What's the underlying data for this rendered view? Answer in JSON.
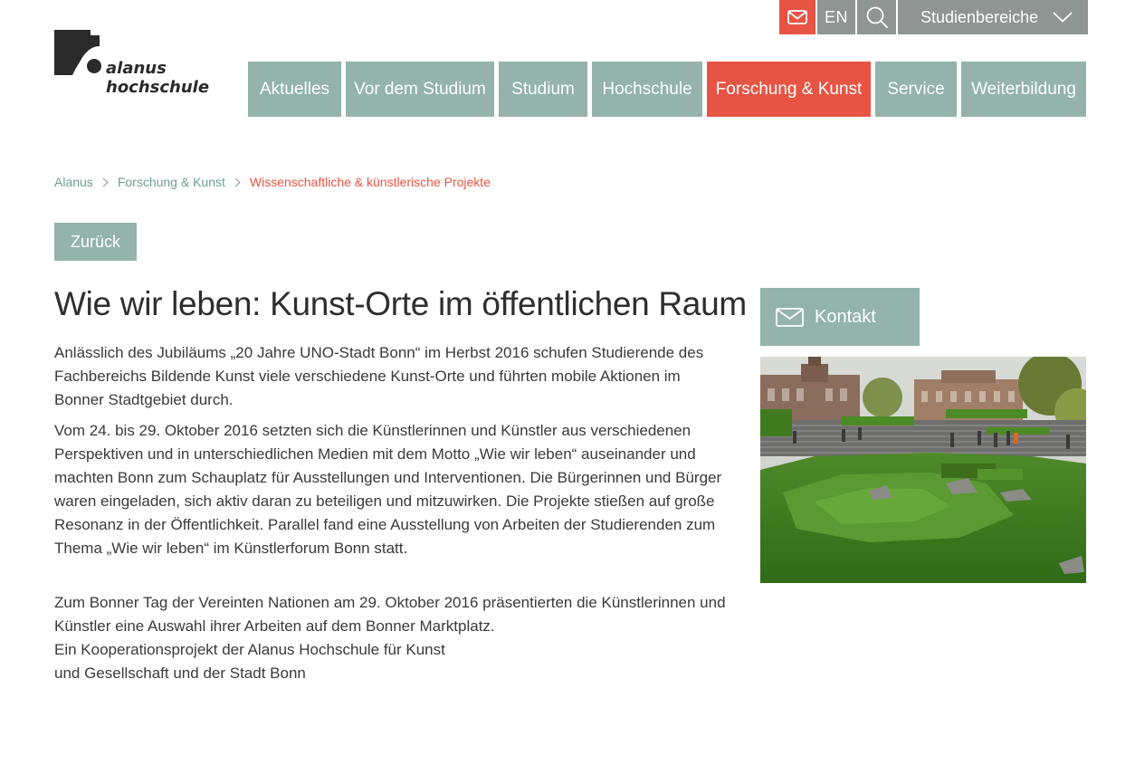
{
  "utility": {
    "language": "EN",
    "study_areas": "Studienbereiche"
  },
  "logo": {
    "line1": "alanus",
    "line2": "hochschule"
  },
  "nav": {
    "items": [
      {
        "label": "Aktuelles"
      },
      {
        "label": "Vor dem Studium"
      },
      {
        "label": "Studium"
      },
      {
        "label": "Hochschule"
      },
      {
        "label": "Forschung & Kunst"
      },
      {
        "label": "Service"
      },
      {
        "label": "Weiterbildung"
      }
    ],
    "active_index": 4
  },
  "breadcrumb": {
    "items": [
      "Alanus",
      "Forschung & Kunst"
    ],
    "current": "Wissenschaftliche & künstlerische Projekte"
  },
  "back_label": "Zurück",
  "article": {
    "title": "Wie wir leben: Kunst-Orte im öffentlichen Raum",
    "p1": "Anlässlich des Jubiläums „20 Jahre UNO-Stadt Bonn“ im Herbst 2016 schufen Studierende des Fachbereichs Bildende Kunst viele verschiedene Kunst-Orte und führten mobile Aktionen im Bonner Stadtgebiet durch.",
    "p2": "Vom 24. bis 29. Oktober 2016 setzten sich die Künstlerinnen und Künstler aus verschiedenen Perspektiven und in unterschiedlichen Medien mit dem Motto „Wie wir leben“ auseinander und machten Bonn zum Schauplatz für Ausstellungen und Interventionen. Die Bürgerinnen und Bürger waren eingeladen, sich aktiv daran zu beteiligen und mitzuwirken. Die Projekte stießen auf große Resonanz in der Öffentlichkeit. Parallel fand eine Ausstellung von Arbeiten der Studierenden zum Thema „Wie wir leben“ im Künstlerforum Bonn statt.",
    "p3": "Zum Bonner Tag der Vereinten Nationen am 29. Oktober 2016 präsentierten die Künstlerinnen und Künstler eine Auswahl ihrer Arbeiten auf dem Bonner Marktplatz.",
    "p4_line1": "Ein Kooperationsprojekt der Alanus Hochschule für Kunst",
    "p4_line2": "und Gesellschaft und der Stadt Bonn"
  },
  "sidebar": {
    "contact_label": "Kontakt"
  },
  "colors": {
    "accent_red": "#e85444",
    "nav_green": "#93b3ab",
    "util_grey": "#8e9592",
    "link_green": "#6f9d93"
  }
}
